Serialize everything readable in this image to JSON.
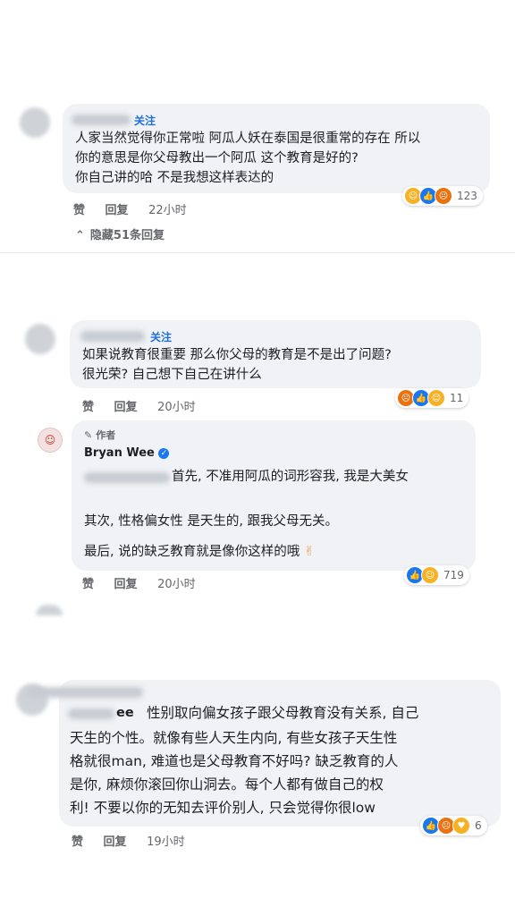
{
  "comment1": {
    "follow_label": "关注",
    "lines": [
      "人家当然觉得你正常啦 阿瓜人妖在泰国是很重常的存在 所以",
      "你的意思是你父母教出一个阿瓜 这个教育是好的?",
      "你自己讲的哈 不是我想这样表达的"
    ],
    "like_label": "赞",
    "reply_label": "回复",
    "time": "22小时",
    "reaction_count": "123",
    "hide_replies": "隐藏51条回复"
  },
  "comment2": {
    "follow_label": "关注",
    "lines": [
      "如果说教育很重要 那么你父母的教育是不是出了问题?",
      "很光荣? 自己想下自己在讲什么"
    ],
    "like_label": "赞",
    "reply_label": "回复",
    "time": "20小时",
    "reaction_count": "11"
  },
  "reply": {
    "author_badge": "作者",
    "author_name": "Bryan Wee",
    "line1": "首先, 不准用阿瓜的词形容我, 我是大美女",
    "line2": "其次, 性格偏女性 是天生的, 跟我父母无关。",
    "line3": "最后, 说的缺乏教育就是像你这样的哦",
    "like_label": "赞",
    "reply_label": "回复",
    "time": "20小时",
    "reaction_count": "719"
  },
  "comment3": {
    "name_partial": "ee",
    "lines": [
      "性别取向偏女孩子跟父母教育没有关系, 自己",
      "天生的个性。就像有些人天生内向, 有些女孩子天生性",
      "格就很man, 难道也是父母教育不好吗? 缺乏教育的人",
      "是你, 麻烦你滚回你山洞去。每个人都有做自己的权",
      "利! 不要以你的无知去评价别人, 只会觉得你很low"
    ],
    "like_label": "赞",
    "reply_label": "回复",
    "time": "19小时",
    "reaction_count": "6"
  }
}
